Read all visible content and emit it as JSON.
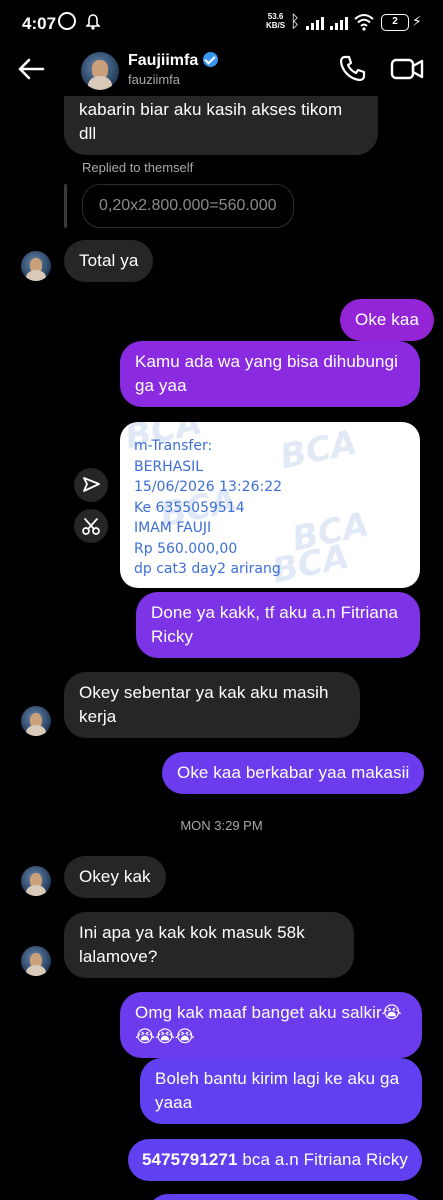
{
  "status_bar": {
    "time": "4:07",
    "net_speed_value": "53.6",
    "net_speed_unit": "KB/S",
    "battery": "2"
  },
  "header": {
    "name": "Faujiimfa",
    "handle": "fauziimfa"
  },
  "messages": {
    "partial": "kabarin biar aku kasih akses tikom\ndll",
    "reply_label": "Replied to themself",
    "reply_quote": "0,20x2.800.000=560.000",
    "m1": "Total ya",
    "m2": "Oke kaa",
    "m3": "Kamu ada wa yang bisa dihubungi ga yaa",
    "transfer_lines": "m-Transfer:\nBERHASIL\n15/06/2026 13:26:22\nKe 6355059514\nIMAM FAUJI\nRp 560.000,00\ndp cat3 day2 arirang",
    "transfer_watermark": "BCA",
    "m4": "Done ya kakk, tf aku a.n Fitriana Ricky",
    "m5": "Okey sebentar ya kak aku masih kerja",
    "m6": "Oke kaa berkabar yaa makasii",
    "timestamp": "MON 3:29 PM",
    "m7": "Okey kak",
    "m8": "Ini apa ya kak kok masuk 58k lalamove?",
    "m9": "Omg kak maaf banget aku salkir😭\n😭😭😭",
    "m10": "Boleh bantu kirim lagi ke aku ga yaaa",
    "m11_number": "5475791271",
    "m11_rest": " bca a.n Fitriana Ricky"
  },
  "colors": {
    "background": "#000000",
    "incoming": "#262626",
    "outgoing_top": "#9425d6",
    "outgoing_bottom": "#6040f0",
    "verified": "#3897f0",
    "transfer_text": "#3d6fd6"
  },
  "icons": {
    "back": "arrow-left-icon",
    "call": "phone-icon",
    "video": "video-camera-icon",
    "forward": "send-icon",
    "reply_sticker": "scissors-icon"
  }
}
